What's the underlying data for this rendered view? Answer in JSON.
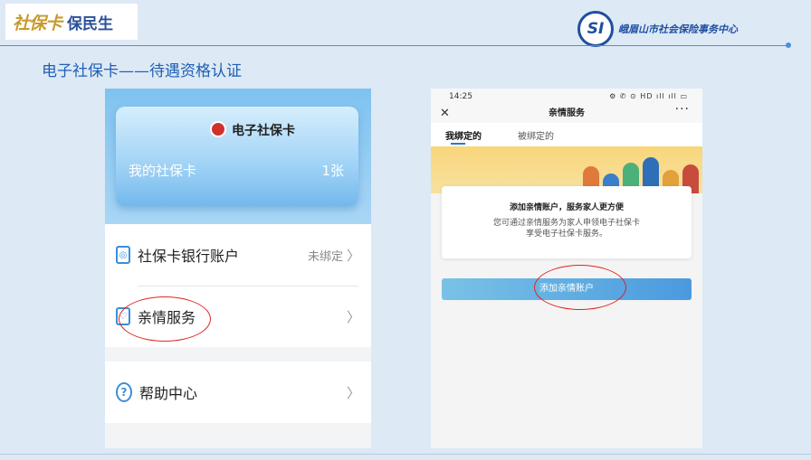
{
  "header": {
    "logo_left_script": "社保卡",
    "logo_left_bold": "保民生",
    "logo_right_badge": "SI",
    "logo_right_text": "峨眉山市社会保险事务中心"
  },
  "slide_title": "电子社保卡——待遇资格认证",
  "left_phone": {
    "card_title": "电子社保卡",
    "card_subtitle": "我的社保卡",
    "card_count": "1张",
    "items": [
      {
        "label": "社保卡银行账户",
        "status": "未绑定",
        "chevron": "〉"
      },
      {
        "label": "亲情服务",
        "status": "",
        "chevron": "〉"
      },
      {
        "label": "帮助中心",
        "status": "",
        "chevron": "〉"
      }
    ]
  },
  "right_phone": {
    "status_time": "14:25",
    "status_icons": "⚙ ✆ ⊙ HD ıll ıll ▭",
    "nav_close": "✕",
    "nav_title": "亲情服务",
    "nav_more": "···",
    "tabs": [
      {
        "label": "我绑定的",
        "active": true
      },
      {
        "label": "被绑定的",
        "active": false
      }
    ],
    "card_title": "添加亲情账户，服务家人更方便",
    "card_line1": "您可通过亲情服务为家人申领电子社保卡",
    "card_line2": "享受电子社保卡服务。",
    "button_label": "添加亲情账户"
  },
  "colors": {
    "accent": "#1f5fb5",
    "annotation": "#e12424"
  }
}
